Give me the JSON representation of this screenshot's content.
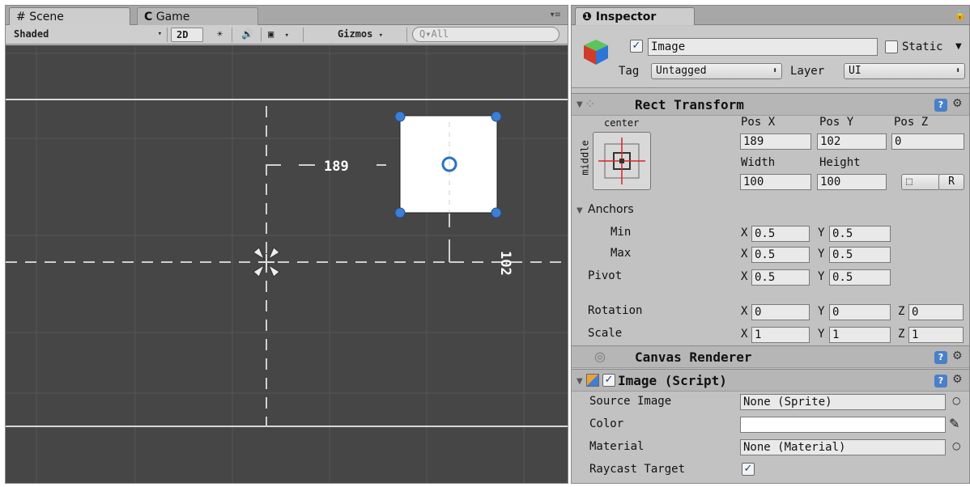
{
  "scene": {
    "tabs": [
      {
        "icon": "#",
        "label": "Scene"
      },
      {
        "icon": "C",
        "label": "Game"
      }
    ],
    "toolbar": {
      "shading": "Shaded",
      "mode_2d": "2D",
      "gizmos": "Gizmos",
      "search_placeholder": "All"
    },
    "measure_x": "189",
    "measure_y": "102"
  },
  "inspector": {
    "tab_label": "Inspector",
    "object": {
      "active": true,
      "name": "Image",
      "static_label": "Static",
      "tag_label": "Tag",
      "tag_value": "Untagged",
      "layer_label": "Layer",
      "layer_value": "UI"
    },
    "rect_transform": {
      "title": "Rect Transform",
      "anchor_h": "center",
      "anchor_v": "middle",
      "headers": [
        "Pos X",
        "Pos Y",
        "Pos Z"
      ],
      "pos_values": [
        "189",
        "102",
        "0"
      ],
      "size_headers": [
        "Width",
        "Height"
      ],
      "size_values": [
        "100",
        "100"
      ],
      "raw_button": "R",
      "anchors_label": "Anchors",
      "min_label": "Min",
      "max_label": "Max",
      "pivot_label": "Pivot",
      "rotation_label": "Rotation",
      "scale_label": "Scale",
      "axis_x": "X",
      "axis_y": "Y",
      "axis_z": "Z",
      "anchor_min": [
        "0.5",
        "0.5"
      ],
      "anchor_max": [
        "0.5",
        "0.5"
      ],
      "pivot": [
        "0.5",
        "0.5"
      ],
      "rotation": [
        "0",
        "0",
        "0"
      ],
      "scale": [
        "1",
        "1",
        "1"
      ]
    },
    "canvas_renderer": {
      "title": "Canvas Renderer"
    },
    "image_script": {
      "title": "Image (Script)",
      "enabled": true,
      "source_image_label": "Source Image",
      "source_image_value": "None (Sprite)",
      "color_label": "Color",
      "color_value": "#ffffff",
      "material_label": "Material",
      "material_value": "None (Material)",
      "raycast_label": "Raycast Target",
      "raycast_value": true
    }
  }
}
